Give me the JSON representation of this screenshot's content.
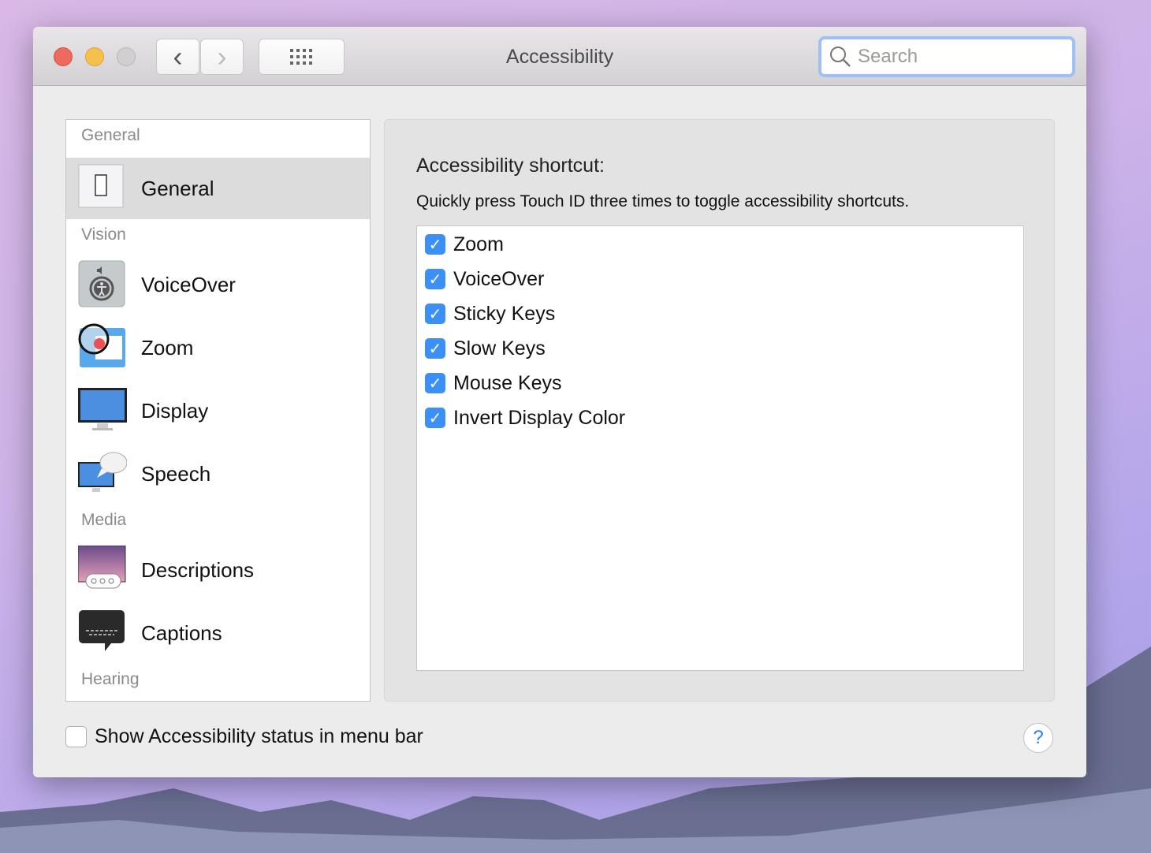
{
  "window": {
    "title": "Accessibility",
    "search_placeholder": "Search",
    "back": "‹",
    "forward": "›",
    "grid": "⠿"
  },
  "sidebar": {
    "sections": [
      "General",
      "Vision",
      "Media",
      "Hearing"
    ],
    "items": [
      {
        "label": "General",
        "icon": "general-switch-icon",
        "selected": true
      },
      {
        "label": "VoiceOver",
        "icon": "voiceover-icon"
      },
      {
        "label": "Zoom",
        "icon": "zoom-icon"
      },
      {
        "label": "Display",
        "icon": "display-icon"
      },
      {
        "label": "Speech",
        "icon": "speech-icon"
      },
      {
        "label": "Descriptions",
        "icon": "descriptions-icon"
      },
      {
        "label": "Captions",
        "icon": "captions-icon"
      }
    ]
  },
  "main": {
    "heading": "Accessibility shortcut:",
    "description": "Quickly press Touch ID three times to toggle accessibility shortcuts.",
    "shortcuts": [
      {
        "label": "Zoom",
        "checked": true
      },
      {
        "label": "VoiceOver",
        "checked": true
      },
      {
        "label": "Sticky Keys",
        "checked": true
      },
      {
        "label": "Slow Keys",
        "checked": true
      },
      {
        "label": "Mouse Keys",
        "checked": true
      },
      {
        "label": "Invert Display Color",
        "checked": true
      }
    ]
  },
  "footer": {
    "status_label": "Show Accessibility status in menu bar",
    "status_checked": false,
    "help": "?"
  },
  "colors": {
    "accent": "#3b8ff5"
  }
}
